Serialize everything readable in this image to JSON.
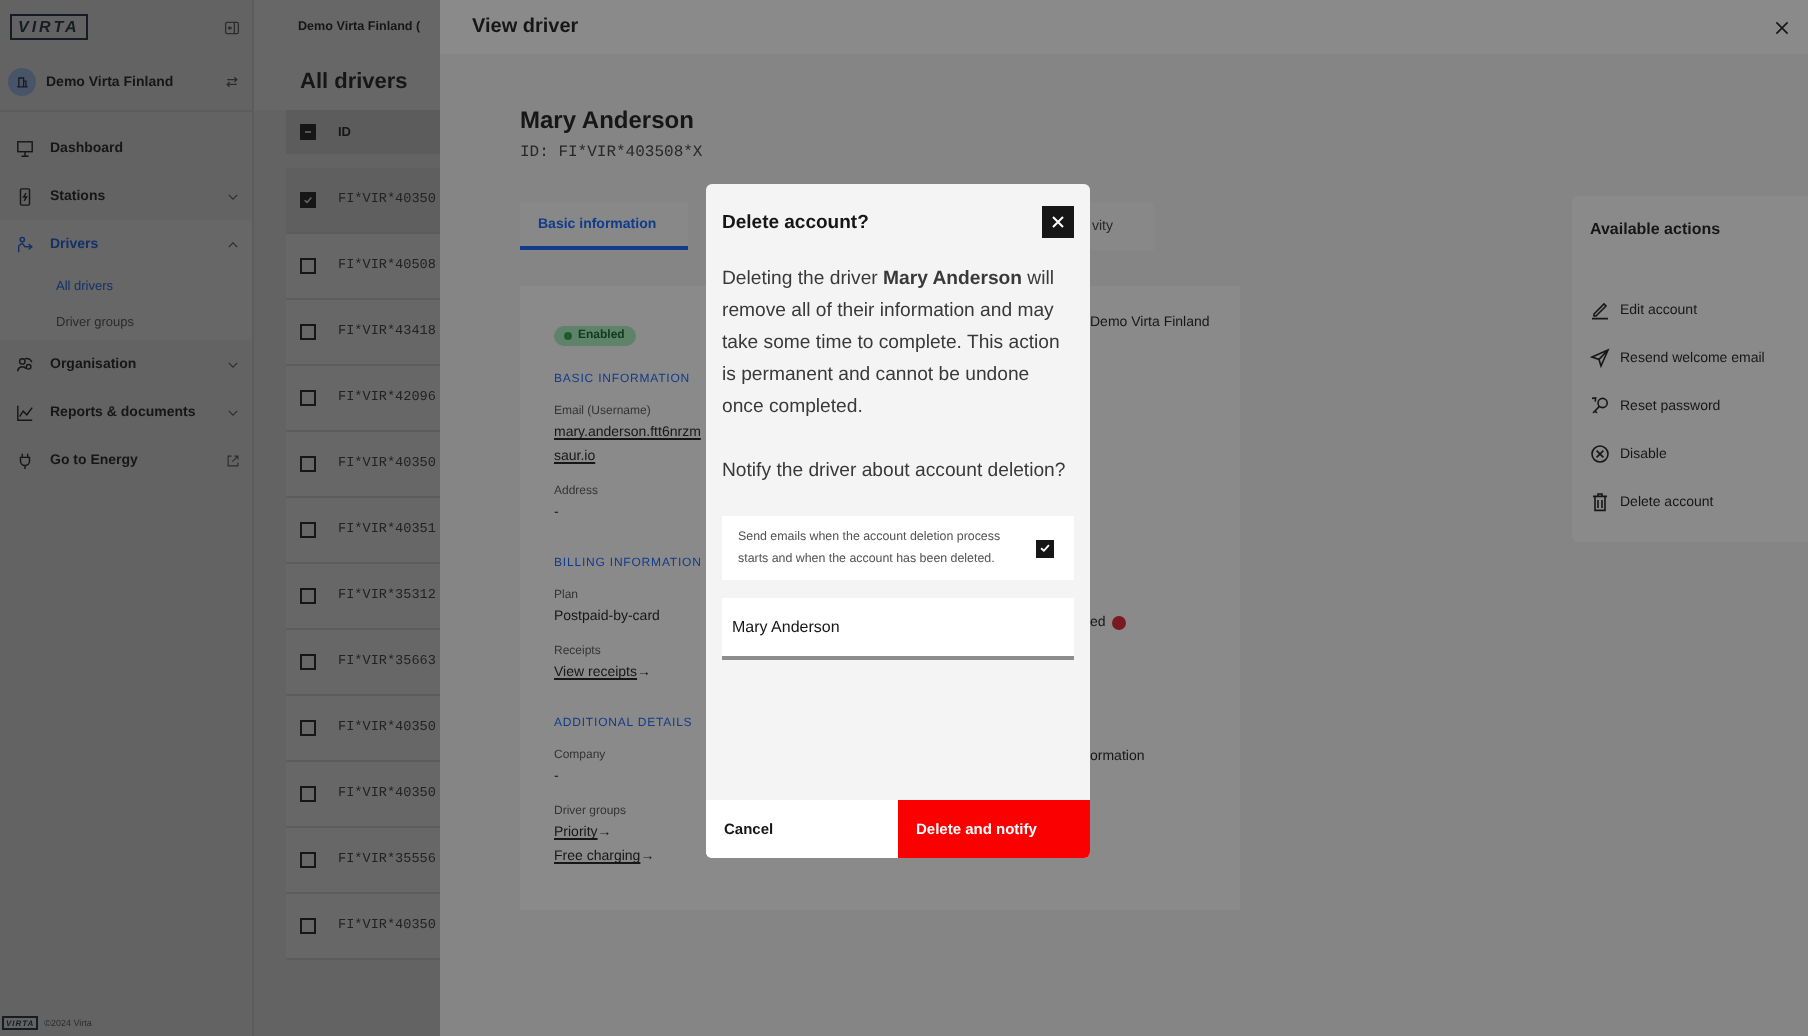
{
  "sidebar": {
    "logo": "VIRTA",
    "organisation": "Demo Virta Finland",
    "nav": [
      {
        "label": "Dashboard",
        "kind": "link",
        "selected": false
      },
      {
        "label": "Stations",
        "kind": "group",
        "expanded": false,
        "selected": false
      },
      {
        "label": "Drivers",
        "kind": "group",
        "expanded": true,
        "selected": true,
        "children": [
          {
            "label": "All drivers",
            "selected": true
          },
          {
            "label": "Driver groups",
            "selected": false
          }
        ]
      },
      {
        "label": "Organisation",
        "kind": "group",
        "expanded": false,
        "selected": false
      },
      {
        "label": "Reports & documents",
        "kind": "group",
        "expanded": false,
        "selected": false
      },
      {
        "label": "Go to Energy",
        "kind": "external",
        "selected": false
      }
    ],
    "footer_logo": "VIRTA",
    "copyright": "©2024 Virta"
  },
  "drivers_list": {
    "organisation": "Demo Virta Finland (",
    "title": "All drivers",
    "indeterminate": true,
    "column": "ID",
    "rows": [
      {
        "id": "FI*VIR*40350",
        "selected": true
      },
      {
        "id": "FI*VIR*40508",
        "selected": false
      },
      {
        "id": "FI*VIR*43418",
        "selected": false
      },
      {
        "id": "FI*VIR*42096",
        "selected": false
      },
      {
        "id": "FI*VIR*40350",
        "selected": false
      },
      {
        "id": "FI*VIR*40351",
        "selected": false
      },
      {
        "id": "FI*VIR*35312",
        "selected": false
      },
      {
        "id": "FI*VIR*35663",
        "selected": false
      },
      {
        "id": "FI*VIR*40350",
        "selected": false
      },
      {
        "id": "FI*VIR*40350",
        "selected": false
      },
      {
        "id": "FI*VIR*35556",
        "selected": false
      },
      {
        "id": "FI*VIR*40350",
        "selected": false
      }
    ]
  },
  "drawer": {
    "title": "View driver",
    "name": "Mary Anderson",
    "driver_id": "ID: FI*VIR*403508*X",
    "tabs": [
      {
        "label": "Basic information",
        "selected": true
      },
      {
        "label": "vity",
        "selected": false
      }
    ],
    "status": {
      "label": "Enabled",
      "enabled": true
    },
    "sections": [
      {
        "heading": "BASIC INFORMATION",
        "fields": [
          {
            "label": "Email (Username)",
            "links": [
              {
                "text": "mary.anderson.ftt6nrzm"
              },
              {
                "text": "saur.io"
              }
            ]
          },
          {
            "label": "Address",
            "value": "-"
          }
        ]
      },
      {
        "heading": "BILLING INFORMATION",
        "fields": [
          {
            "label": "Plan",
            "value": "Postpaid-by-card"
          },
          {
            "label": "Receipts",
            "links": [
              {
                "text": "View receipts",
                "arrow": "→"
              }
            ]
          }
        ]
      },
      {
        "heading": "ADDITIONAL DETAILS",
        "fields": [
          {
            "label": "Company",
            "value": "-"
          },
          {
            "label": "Driver groups",
            "links": [
              {
                "text": "Priority",
                "arrow": "→"
              },
              {
                "text": "Free charging",
                "arrow": "→"
              }
            ]
          }
        ]
      }
    ],
    "side_fragments": [
      {
        "text": "Demo Virta Finland",
        "alert": false
      },
      {
        "text": "ed",
        "alert": true
      },
      {
        "text": "ormation",
        "alert": false
      }
    ],
    "actions_title": "Available actions",
    "actions": [
      {
        "label": "Edit account"
      },
      {
        "label": "Resend welcome email"
      },
      {
        "label": "Reset password"
      },
      {
        "label": "Disable"
      },
      {
        "label": "Delete account"
      }
    ]
  },
  "dialog": {
    "title": "Delete account?",
    "message": "Deleting the driver **Mary Anderson** will remove all of their information and may take some time to complete. This action is permanent and cannot be undone once completed.",
    "question": "Notify the driver about account deletion?",
    "notify_option": {
      "label": "Send emails when the account deletion process starts and when the account has been deleted.",
      "checked": true
    },
    "name_input": "Mary Anderson",
    "cancel": "Cancel",
    "confirm": "Delete and notify"
  }
}
